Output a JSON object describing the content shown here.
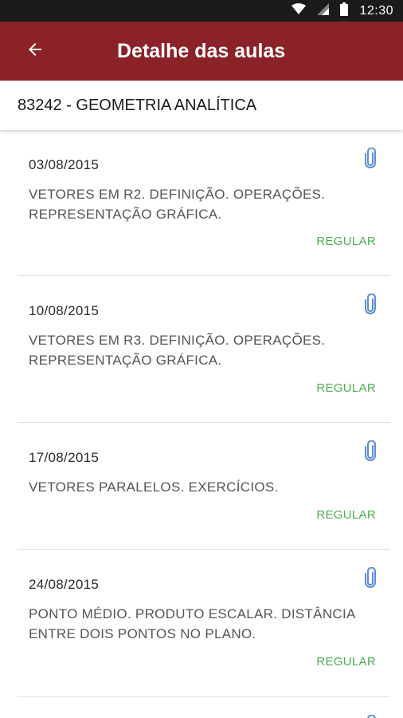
{
  "status_bar": {
    "time": "12:30",
    "icons": [
      "wifi-icon",
      "signal-icon",
      "battery-icon"
    ]
  },
  "app_bar": {
    "title": "Detalhe das aulas",
    "back_icon": "arrow-left-icon",
    "background": "#8a2228"
  },
  "course": {
    "title": "83242 - GEOMETRIA ANALÍTICA"
  },
  "lessons": [
    {
      "date": "03/08/2015",
      "description": "VETORES EM R2. DEFINIÇÃO. OPERAÇÕES. REPRESENTAÇÃO GRÁFICA.",
      "status": "REGULAR",
      "icon": "paperclip-icon"
    },
    {
      "date": "10/08/2015",
      "description": "VETORES EM R3. DEFINIÇÃO. OPERAÇÕES. REPRESENTAÇÃO GRÁFICA.",
      "status": "REGULAR",
      "icon": "paperclip-icon"
    },
    {
      "date": "17/08/2015",
      "description": "VETORES PARALELOS. EXERCÍCIOS.",
      "status": "REGULAR",
      "icon": "paperclip-icon"
    },
    {
      "date": "24/08/2015",
      "description": "PONTO MÉDIO. PRODUTO ESCALAR. DISTÂNCIA ENTRE DOIS PONTOS NO PLANO.",
      "status": "REGULAR",
      "icon": "paperclip-icon"
    }
  ],
  "colors": {
    "accent": "#8a2228",
    "status_regular": "#4caf50",
    "attachment": "#5b8dd6"
  }
}
